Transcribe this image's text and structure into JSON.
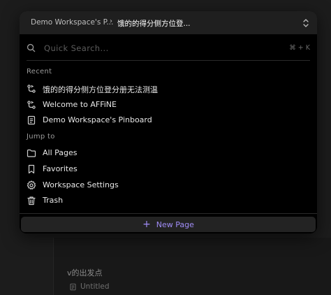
{
  "header": {
    "workspace": "Demo Workspace's P...",
    "separator": "›",
    "page": "饿的的得分侧方位登...",
    "toggle_icon": "chevron-up-down-icon"
  },
  "search": {
    "placeholder": "Quick Search...",
    "shortcut": "⌘ + K",
    "icon": "search-icon"
  },
  "recent": {
    "label": "Recent",
    "items": [
      {
        "label": "饿的的得分侧方位登分册无法测温",
        "icon": "edgeless-icon"
      },
      {
        "label": "Welcome to AFFiNE",
        "icon": "edgeless-icon"
      },
      {
        "label": "Demo Workspace's Pinboard",
        "icon": "page-icon"
      }
    ]
  },
  "jump_to": {
    "label": "Jump to",
    "items": [
      {
        "label": "All Pages",
        "icon": "folder-icon"
      },
      {
        "label": "Favorites",
        "icon": "bookmark-icon"
      },
      {
        "label": "Workspace Settings",
        "icon": "gear-icon"
      },
      {
        "label": "Trash",
        "icon": "trash-icon"
      }
    ]
  },
  "footer": {
    "new_page_label": "New Page",
    "plus": "+"
  },
  "background": {
    "heading": "v的出发点",
    "page": "Untitled"
  },
  "colors": {
    "accent": "#a08cf6",
    "dialog_bg": "#000000",
    "header_bg": "#1f1f1f"
  }
}
